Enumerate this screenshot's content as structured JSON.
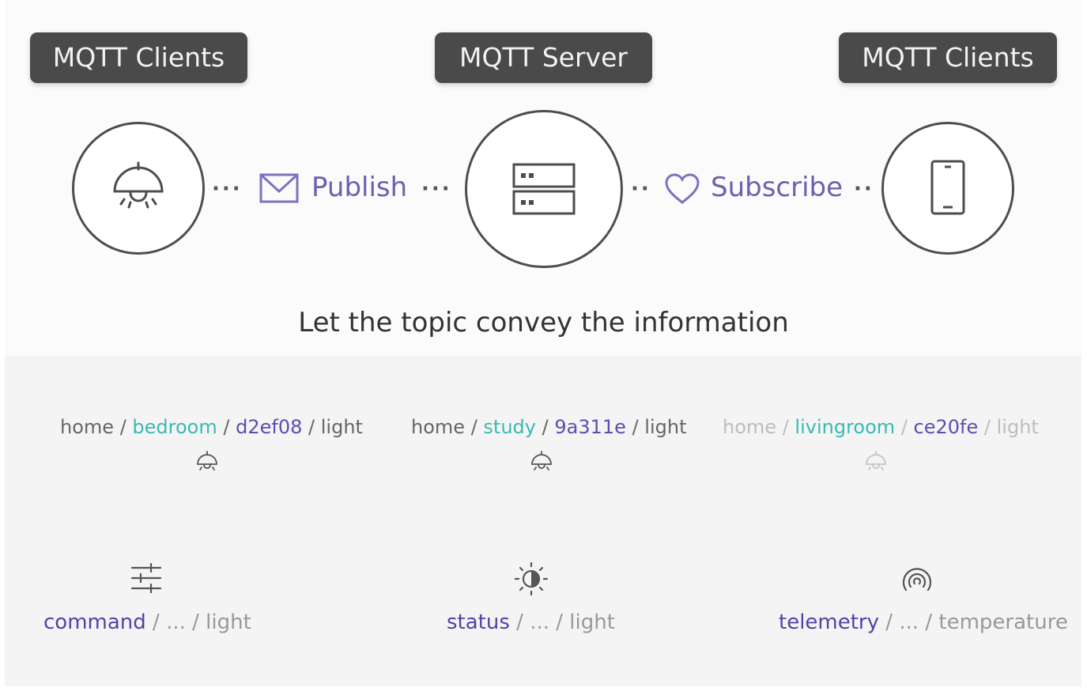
{
  "header": {
    "left_label": "MQTT Clients",
    "center_label": "MQTT Server",
    "right_label": "MQTT Clients"
  },
  "flow": {
    "publish_label": "Publish",
    "subscribe_label": "Subscribe",
    "publish_icon": "envelope-icon",
    "subscribe_icon": "heart-icon"
  },
  "nodes": {
    "left_icon": "ceiling-lamp-icon",
    "center_icon": "server-icon",
    "right_icon": "smartphone-icon"
  },
  "caption": "Let the topic convey the information",
  "separator": "/",
  "topics": [
    {
      "root": "home",
      "room": "bedroom",
      "id": "d2ef08",
      "device": "light",
      "icon": "lamp-icon"
    },
    {
      "root": "home",
      "room": "study",
      "id": "9a311e",
      "device": "light",
      "icon": "lamp-icon"
    },
    {
      "root": "home",
      "room": "livingroom",
      "id": "ce20fe",
      "device": "light",
      "icon": "lamp-icon"
    }
  ],
  "families": [
    {
      "keyword": "command",
      "ellipsis": "...",
      "leaf": "light",
      "icon": "sliders-icon"
    },
    {
      "keyword": "status",
      "ellipsis": "...",
      "leaf": "light",
      "icon": "brightness-icon"
    },
    {
      "keyword": "telemetry",
      "ellipsis": "...",
      "leaf": "temperature",
      "icon": "signal-icon"
    }
  ],
  "colors": {
    "tag_bg": "#4a4a4a",
    "accent_purple": "#5a4fb0",
    "accent_teal": "#3bbab3",
    "text_gray": "#666666"
  }
}
